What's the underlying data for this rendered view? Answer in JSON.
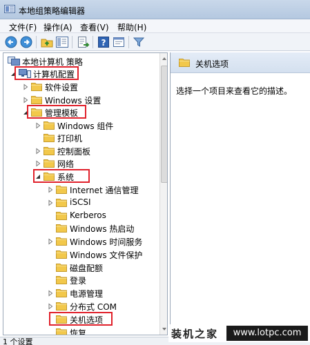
{
  "window": {
    "title": "本地组策略编辑器"
  },
  "menu": [
    {
      "label": "文件(F)"
    },
    {
      "label": "操作(A)"
    },
    {
      "label": "查看(V)"
    },
    {
      "label": "帮助(H)"
    }
  ],
  "toolbar": {
    "buttons": [
      {
        "name": "back-button",
        "icon": "back-arrow-icon"
      },
      {
        "name": "forward-button",
        "icon": "forward-arrow-icon"
      },
      {
        "name": "up-folder-button",
        "icon": "up-folder-icon"
      },
      {
        "name": "show-hide-tree-button",
        "icon": "tree-pane-icon"
      },
      {
        "name": "export-list-button",
        "icon": "export-icon"
      },
      {
        "name": "help-button",
        "icon": "help-icon"
      },
      {
        "name": "properties-button",
        "icon": "properties-icon"
      },
      {
        "name": "filter-button",
        "icon": "filter-icon"
      }
    ]
  },
  "tree": {
    "items": [
      {
        "label": "本地计算机 策略",
        "icon": "policy-icon",
        "expand": "none"
      },
      {
        "label": "计算机配置",
        "icon": "computer-icon",
        "expand": "expanded",
        "highlighted": true
      },
      {
        "label": "软件设置",
        "icon": "folder-icon",
        "expand": "collapsed"
      },
      {
        "label": "Windows 设置",
        "icon": "folder-icon",
        "expand": "collapsed"
      },
      {
        "label": "管理模板",
        "icon": "folder-icon",
        "expand": "expanded",
        "highlighted": true
      },
      {
        "label": "Windows 组件",
        "icon": "folder-icon",
        "expand": "collapsed"
      },
      {
        "label": "打印机",
        "icon": "folder-icon",
        "expand": "none"
      },
      {
        "label": "控制面板",
        "icon": "folder-icon",
        "expand": "collapsed"
      },
      {
        "label": "网络",
        "icon": "folder-icon",
        "expand": "collapsed"
      },
      {
        "label": "系统",
        "icon": "folder-icon",
        "expand": "expanded",
        "highlighted": true
      },
      {
        "label": "Internet 通信管理",
        "icon": "folder-icon",
        "expand": "collapsed"
      },
      {
        "label": "iSCSI",
        "icon": "folder-icon",
        "expand": "collapsed"
      },
      {
        "label": "Kerberos",
        "icon": "folder-icon",
        "expand": "none"
      },
      {
        "label": "Windows 热启动",
        "icon": "folder-icon",
        "expand": "none"
      },
      {
        "label": "Windows 时间服务",
        "icon": "folder-icon",
        "expand": "collapsed"
      },
      {
        "label": "Windows 文件保护",
        "icon": "folder-icon",
        "expand": "none"
      },
      {
        "label": "磁盘配额",
        "icon": "folder-icon",
        "expand": "none"
      },
      {
        "label": "登录",
        "icon": "folder-icon",
        "expand": "none"
      },
      {
        "label": "电源管理",
        "icon": "folder-icon",
        "expand": "collapsed"
      },
      {
        "label": "分布式 COM",
        "icon": "folder-icon",
        "expand": "collapsed"
      },
      {
        "label": "关机选项",
        "icon": "folder-icon",
        "expand": "none",
        "highlighted": true
      },
      {
        "label": "恢复",
        "icon": "folder-icon",
        "expand": "none"
      }
    ]
  },
  "detail": {
    "title": "关机选项",
    "description": "选择一个项目来查看它的描述。"
  },
  "status": {
    "text": "1 个设置"
  },
  "watermark": {
    "text": "装机之家",
    "url": "www.lotpc.com"
  },
  "colors": {
    "highlight": "#e0202a",
    "folder": "#f2c84b",
    "window_frame": "#b4c8e0"
  }
}
